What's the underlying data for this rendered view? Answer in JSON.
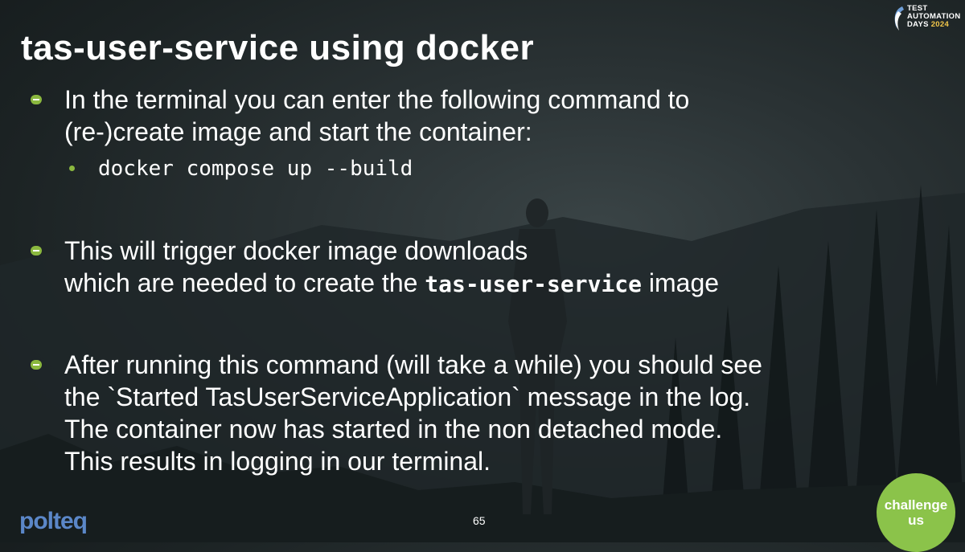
{
  "slide": {
    "title": "tas-user-service using docker",
    "bullets": [
      {
        "lines": [
          "In the terminal you can enter the following command to",
          "(re-)create image and start the container:"
        ],
        "sub": "docker compose up --build"
      },
      {
        "line1": "This will trigger docker image downloads",
        "line2_prefix": "which are needed to create the ",
        "line2_code": "tas-user-service",
        "line2_suffix": " image"
      },
      {
        "lines": [
          "After running this command (will take a while) you should see",
          "the `Started TasUserServiceApplication` message in the log.",
          "The container now has started in the non detached mode.",
          "This results in logging in our terminal."
        ]
      }
    ],
    "page_number": "65"
  },
  "branding": {
    "tad_line1": "TEST",
    "tad_line2": "AUTOMATION",
    "tad_line3": "DAYS",
    "tad_year": "2024",
    "polteq": "polteq",
    "challenge_line1": "challenge",
    "challenge_line2": "us"
  },
  "colors": {
    "accent_green": "#8bb83f",
    "badge_green": "#8bc34a",
    "polteq_blue": "#5b87c8"
  }
}
